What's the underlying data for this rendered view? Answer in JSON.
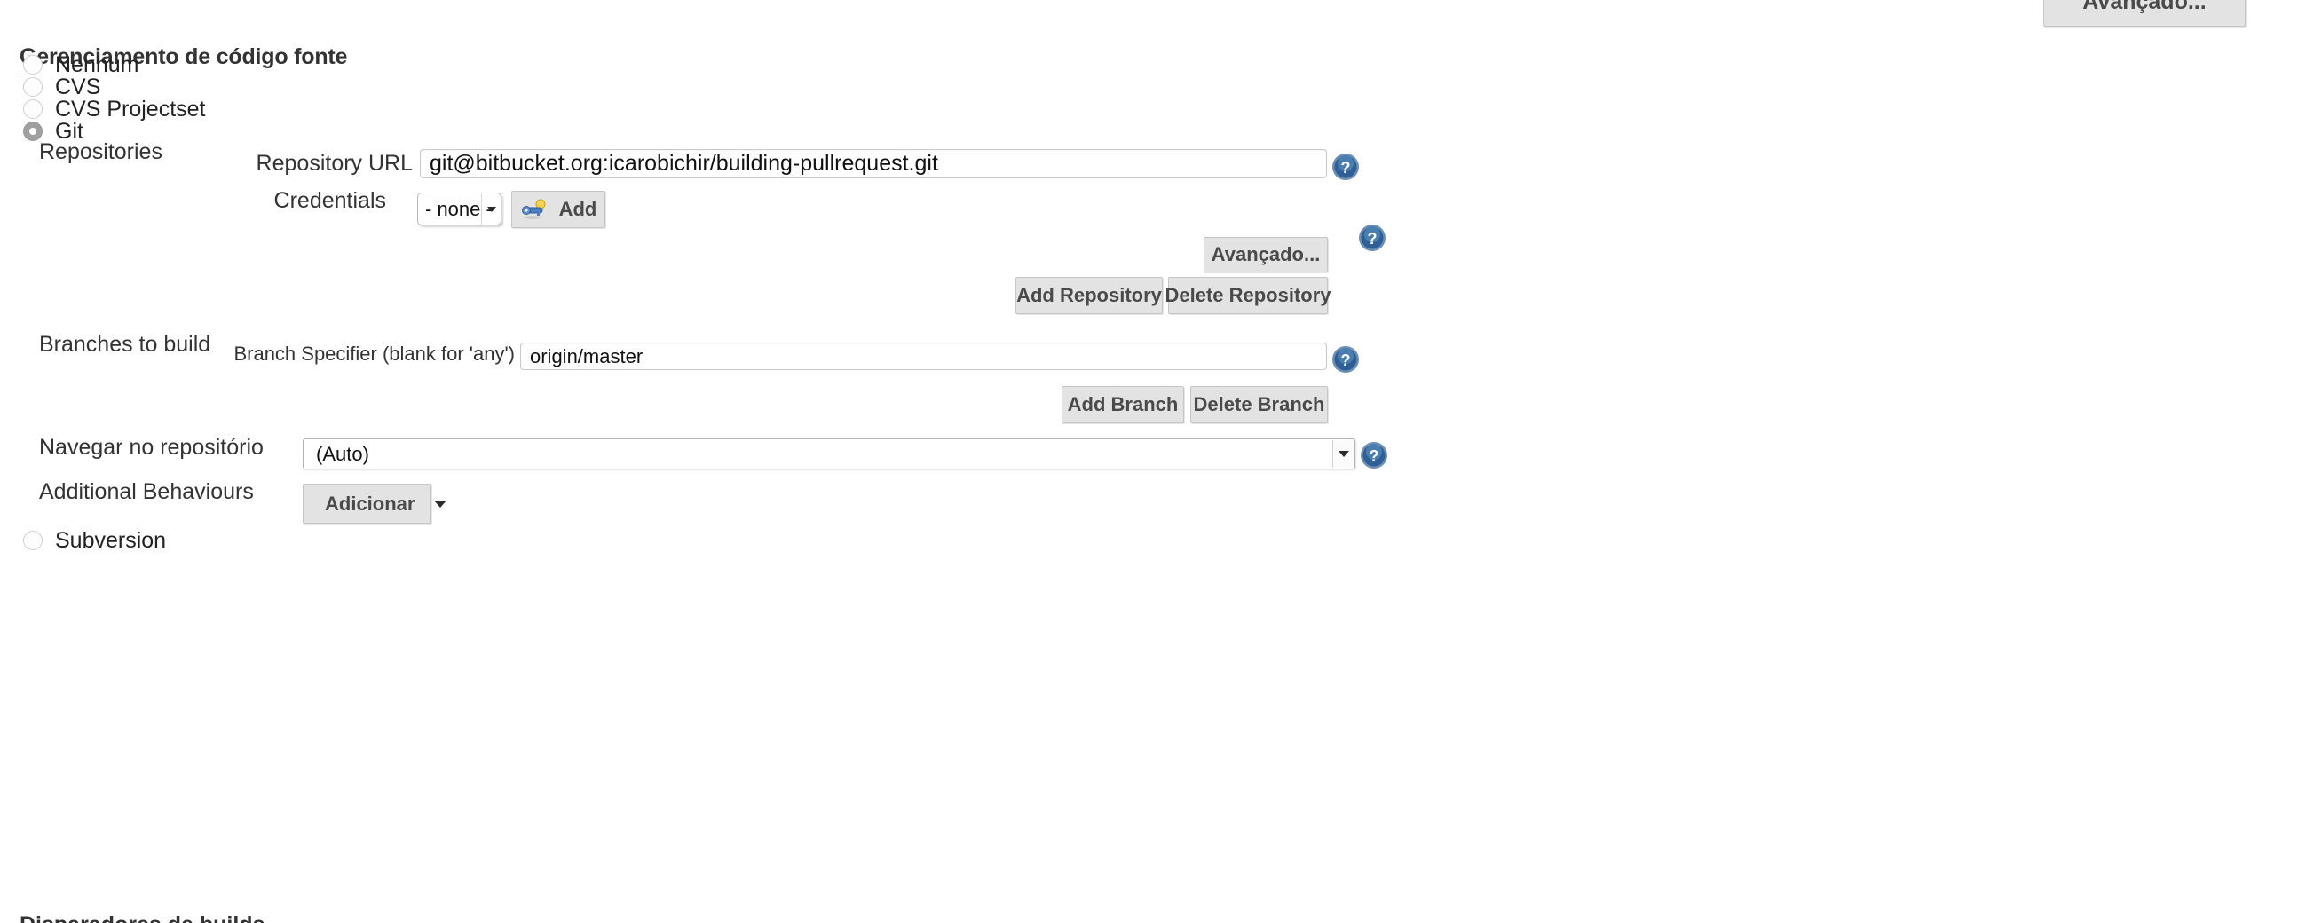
{
  "top_partial": {
    "advanced_button_label": "Avançado..."
  },
  "section": {
    "title": "Gerenciamento de código fonte"
  },
  "scm_options": [
    {
      "label": "Nenhum",
      "selected": false
    },
    {
      "label": "CVS",
      "selected": false
    },
    {
      "label": "CVS Projectset",
      "selected": false
    },
    {
      "label": "Git",
      "selected": true
    },
    {
      "label": "Subversion",
      "selected": false
    }
  ],
  "git": {
    "repositories_label": "Repositories",
    "repository_url_label": "Repository URL",
    "repository_url_value": "git@bitbucket.org:icarobichir/building-pullrequest.git",
    "credentials_label": "Credentials",
    "credentials_value": "- none -",
    "add_credentials_label": "Add",
    "advanced_button_label": "Avançado...",
    "add_repository_label": "Add Repository",
    "delete_repository_label": "Delete Repository",
    "branches_label": "Branches to build",
    "branch_specifier_label": "Branch Specifier (blank for 'any')",
    "branch_specifier_value": "origin/master",
    "add_branch_label": "Add Branch",
    "delete_branch_label": "Delete Branch",
    "repository_browser_label": "Navegar no repositório",
    "repository_browser_value": "(Auto)",
    "additional_behaviours_label": "Additional Behaviours",
    "additional_behaviours_button_label": "Adicionar"
  },
  "icons": {
    "help": "help-icon",
    "key": "key-icon",
    "chevron_down": "chevron-down-icon"
  },
  "colors": {
    "help_blue": "#3a6ea5",
    "button_face": "#e3e3e3",
    "text": "#333333",
    "radio_selected": "#a0a0a0"
  },
  "bottom_partial": {
    "text": "Disparadores de builds"
  }
}
